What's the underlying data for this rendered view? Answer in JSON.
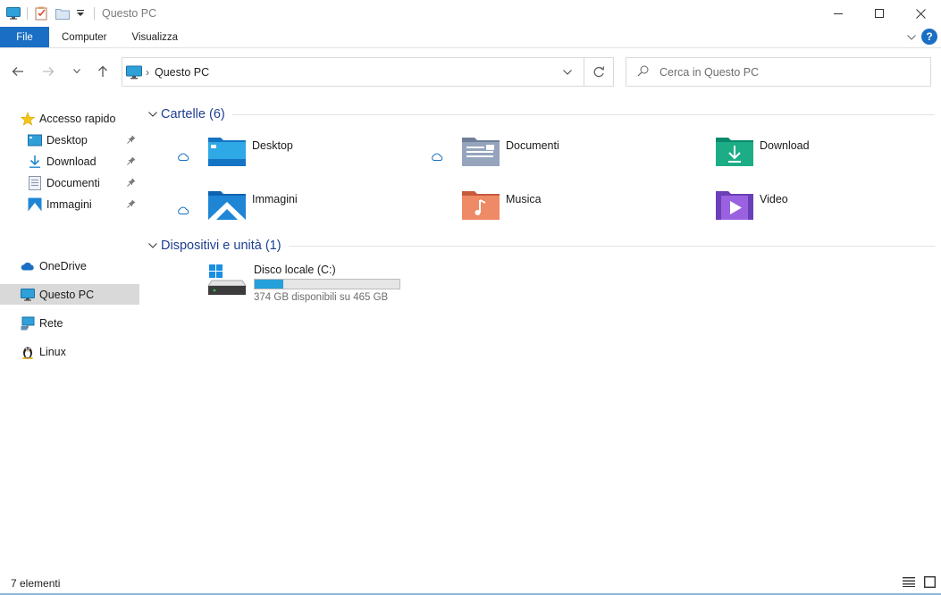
{
  "window": {
    "title": "Questo PC"
  },
  "ribbon": {
    "tabs": [
      "File",
      "Computer",
      "Visualizza"
    ]
  },
  "address": {
    "path": "Questo PC"
  },
  "search": {
    "placeholder": "Cerca in Questo PC"
  },
  "sidebar": {
    "items": [
      {
        "label": "Accesso rapido",
        "icon": "star-icon"
      },
      {
        "label": "Desktop",
        "icon": "desktop-icon",
        "pinned": true
      },
      {
        "label": "Download",
        "icon": "download-icon",
        "pinned": true
      },
      {
        "label": "Documenti",
        "icon": "documents-icon",
        "pinned": true
      },
      {
        "label": "Immagini",
        "icon": "pictures-icon",
        "pinned": true
      },
      {
        "label": "OneDrive",
        "icon": "onedrive-icon"
      },
      {
        "label": "Questo PC",
        "icon": "this-pc-icon",
        "selected": true
      },
      {
        "label": "Rete",
        "icon": "network-icon"
      },
      {
        "label": "Linux",
        "icon": "linux-icon"
      }
    ]
  },
  "folders_group": {
    "title": "Cartelle (6)",
    "items": [
      {
        "name": "Desktop",
        "icon": "desktop-folder-icon",
        "cloud": true
      },
      {
        "name": "Documenti",
        "icon": "documents-folder-icon",
        "cloud": true
      },
      {
        "name": "Download",
        "icon": "download-folder-icon",
        "cloud": false
      },
      {
        "name": "Immagini",
        "icon": "pictures-folder-icon",
        "cloud": true
      },
      {
        "name": "Musica",
        "icon": "music-folder-icon",
        "cloud": false
      },
      {
        "name": "Video",
        "icon": "video-folder-icon",
        "cloud": false
      }
    ]
  },
  "devices_group": {
    "title": "Dispositivi e unità (1)",
    "drive": {
      "name": "Disco locale (C:)",
      "free_text": "374 GB disponibili su 465 GB",
      "used_fraction": 0.196,
      "bar_color": "#26a0da"
    }
  },
  "status": {
    "count": "7 elementi"
  },
  "colors": {
    "accent": "#1a6fc4",
    "group_title": "#1e3f91"
  }
}
